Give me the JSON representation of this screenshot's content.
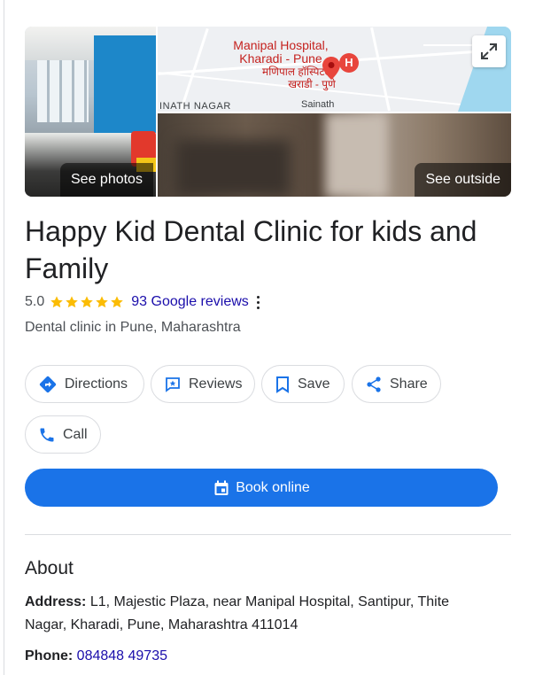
{
  "photos": {
    "see_photos": "See photos",
    "see_outside": "See outside"
  },
  "map": {
    "label_line1": "Manipal Hospital,",
    "label_line2": "Kharadi - Pune",
    "label_hindi1": "मणिपाल हॉस्पिटल,",
    "label_hindi2": "खराडी - पुणे",
    "area_left": "INATH NAGAR",
    "area_right": "Sainath"
  },
  "business": {
    "name": "Happy Kid Dental Clinic for kids and Family",
    "rating": "5.0",
    "stars": 5,
    "reviews_link": "93 Google reviews",
    "category": "Dental clinic in Pune, Maharashtra"
  },
  "actions": {
    "directions": "Directions",
    "reviews": "Reviews",
    "save": "Save",
    "share": "Share",
    "call": "Call",
    "book": "Book online"
  },
  "about": {
    "heading": "About",
    "address_label": "Address:",
    "address_value": "L1, Majestic Plaza, near Manipal Hospital, Santipur, Thite Nagar, Kharadi, Pune, Maharashtra 411014",
    "phone_label": "Phone:",
    "phone_value": "084848 49735"
  },
  "colors": {
    "accent_blue": "#1a73e8",
    "link": "#1a0dab",
    "star": "#fbbc04",
    "map_pin": "#e8453c"
  },
  "icons": {
    "directions": "directions-icon",
    "reviews": "reviews-icon",
    "save": "bookmark-icon",
    "share": "share-icon",
    "call": "phone-icon",
    "book": "calendar-icon",
    "expand": "expand-icon",
    "menu": "more-vert-icon"
  }
}
